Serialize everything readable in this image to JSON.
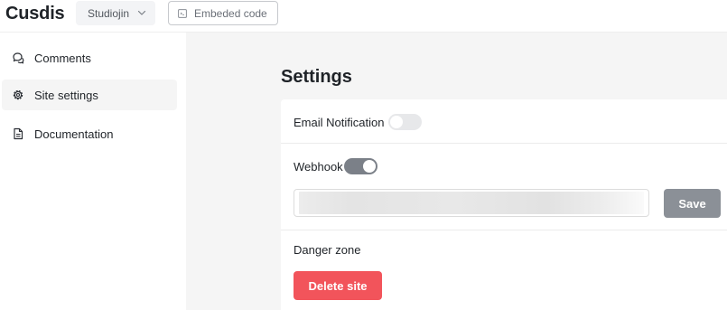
{
  "app": {
    "logo": "Cusdis"
  },
  "header": {
    "site_selector": {
      "label": "Studiojin",
      "icon": "chevron-down-icon"
    },
    "embed_button": {
      "label": "Embeded code",
      "icon": "code-icon"
    }
  },
  "sidebar": {
    "items": [
      {
        "label": "Comments",
        "icon": "chat-bubbles-icon",
        "active": false
      },
      {
        "label": "Site settings",
        "icon": "gear-icon",
        "active": true
      },
      {
        "label": "Documentation",
        "icon": "document-icon",
        "active": false
      }
    ]
  },
  "settings": {
    "title": "Settings",
    "email_notification": {
      "label": "Email Notification",
      "enabled": false
    },
    "webhook": {
      "label": "Webhook",
      "enabled": true,
      "url_value": "",
      "save_label": "Save"
    },
    "danger_zone": {
      "label": "Danger zone",
      "delete_label": "Delete site"
    }
  },
  "colors": {
    "page_background": "#f5f5f5",
    "toggle_on": "#7b8088",
    "toggle_off": "#e7e8ea",
    "save_button": "#8b9097",
    "delete_button": "#f2545b"
  }
}
